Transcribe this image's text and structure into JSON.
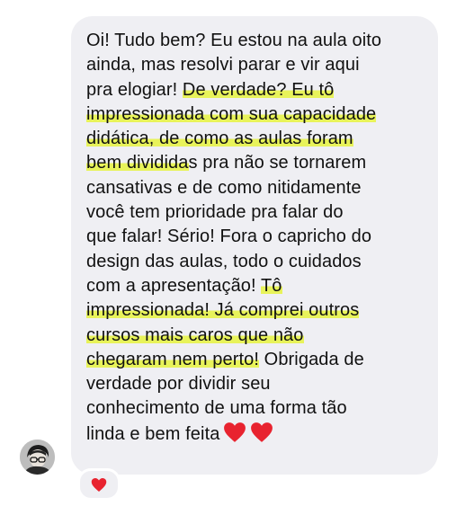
{
  "message": {
    "lines": [
      [
        {
          "t": "Oi! Tudo bem? Eu estou na aula oito",
          "h": false
        }
      ],
      [
        {
          "t": "ainda, mas resolvi parar e vir aqui",
          "h": false
        }
      ],
      [
        {
          "t": "pra elogiar! ",
          "h": false
        },
        {
          "t": "De verdade? Eu tô",
          "h": true
        }
      ],
      [
        {
          "t": "impressionada com sua capacidade",
          "h": true
        }
      ],
      [
        {
          "t": "didática, de como as aulas foram",
          "h": true
        }
      ],
      [
        {
          "t": "bem dividida",
          "h": true
        },
        {
          "t": "s pra não se tornarem",
          "h": false
        }
      ],
      [
        {
          "t": "cansativas e de como nitidamente",
          "h": false
        }
      ],
      [
        {
          "t": "você tem prioridade pra falar do",
          "h": false
        }
      ],
      [
        {
          "t": "que falar! Sério! Fora o capricho do",
          "h": false
        }
      ],
      [
        {
          "t": "design das aulas, todo o cuidados",
          "h": false
        }
      ],
      [
        {
          "t": "com a apresentação! ",
          "h": false
        },
        {
          "t": "Tô",
          "h": true
        }
      ],
      [
        {
          "t": "impressionada! Já comprei outros",
          "h": true
        }
      ],
      [
        {
          "t": "cursos mais caros que não",
          "h": true
        }
      ],
      [
        {
          "t": "chegaram nem perto!",
          "h": true
        },
        {
          "t": " Obrigada de",
          "h": false
        }
      ],
      [
        {
          "t": "verdade por dividir seu",
          "h": false
        }
      ],
      [
        {
          "t": "conhecimento de uma forma tão",
          "h": false
        }
      ],
      [
        {
          "t": "linda e bem feita",
          "h": false
        }
      ]
    ],
    "trailing_emoji": [
      "red-heart",
      "red-heart"
    ],
    "highlight_color": "#e8f35a",
    "bubble_color": "#efeff3"
  },
  "reaction": {
    "emoji": "red-heart",
    "color": "#e8232f"
  },
  "avatar": {
    "icon": "user-avatar"
  }
}
